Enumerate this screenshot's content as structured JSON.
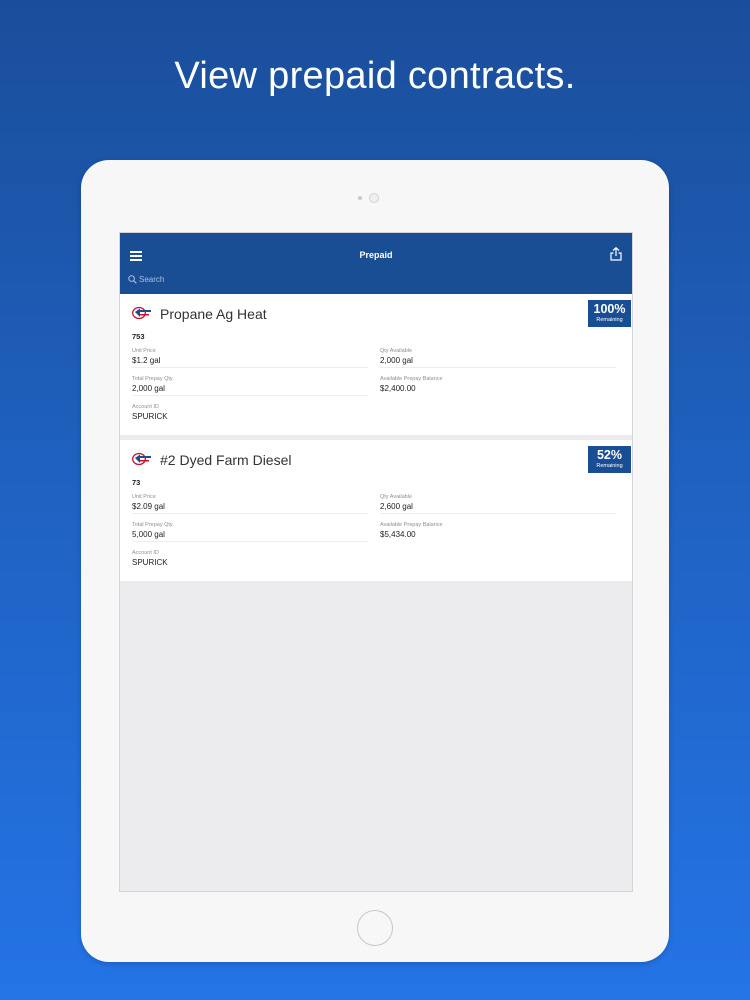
{
  "headline": "View prepaid contracts.",
  "navbar": {
    "title": "Prepaid",
    "menu_icon": "hamburger-menu-icon",
    "share_icon": "share-icon",
    "accent": "#1a4e94"
  },
  "search": {
    "placeholder": "Search"
  },
  "contracts": [
    {
      "title": "Propane Ag Heat",
      "number": "753",
      "percent": "100%",
      "percent_label": "Remaining",
      "unit_price_label": "Unit Price",
      "unit_price": "$1.2 gal",
      "qty_available_label": "Qty Available",
      "qty_available": "2,000 gal",
      "total_prepay_label": "Total Prepay Qty.",
      "total_prepay": "2,000 gal",
      "available_balance_label": "Available Prepay Balance",
      "available_balance": "$2,400.00",
      "account_id_label": "Account ID",
      "account_id": "SPURICK"
    },
    {
      "title": "#2 Dyed Farm Diesel",
      "number": "73",
      "percent": "52%",
      "percent_label": "Remaining",
      "unit_price_label": "Unit Price",
      "unit_price": "$2.09 gal",
      "qty_available_label": "Qty Available",
      "qty_available": "2,600 gal",
      "total_prepay_label": "Total Prepay Qty.",
      "total_prepay": "5,000 gal",
      "available_balance_label": "Available Prepay Balance",
      "available_balance": "$5,434.00",
      "account_id_label": "Account ID",
      "account_id": "SPURICK"
    }
  ]
}
